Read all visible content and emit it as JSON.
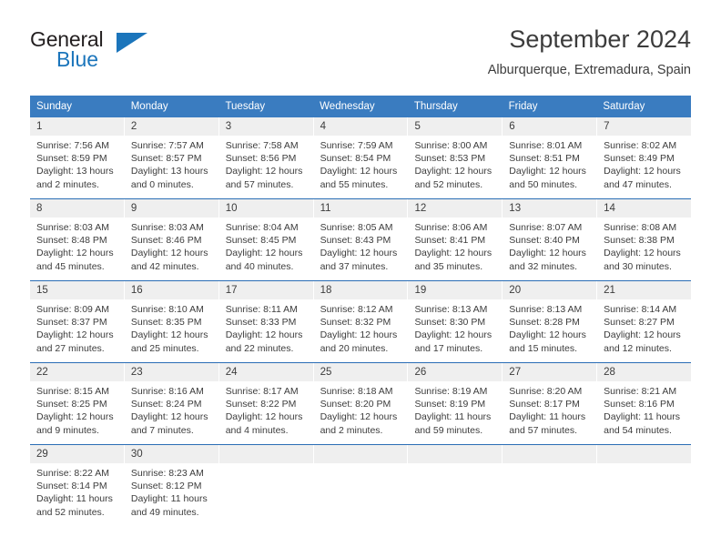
{
  "brand": {
    "name_top": "General",
    "name_bottom": "Blue",
    "accent_color": "#1b75bb"
  },
  "header": {
    "title": "September 2024",
    "subtitle": "Alburquerque, Extremadura, Spain"
  },
  "calendar": {
    "header_bg": "#3a7cc0",
    "row_divider_color": "#2a6db5",
    "day_number_bg": "#efefef",
    "weekdays": [
      "Sunday",
      "Monday",
      "Tuesday",
      "Wednesday",
      "Thursday",
      "Friday",
      "Saturday"
    ],
    "weeks": [
      [
        {
          "day": "1",
          "sunrise": "Sunrise: 7:56 AM",
          "sunset": "Sunset: 8:59 PM",
          "daylight_line1": "Daylight: 13 hours",
          "daylight_line2": "and 2 minutes."
        },
        {
          "day": "2",
          "sunrise": "Sunrise: 7:57 AM",
          "sunset": "Sunset: 8:57 PM",
          "daylight_line1": "Daylight: 13 hours",
          "daylight_line2": "and 0 minutes."
        },
        {
          "day": "3",
          "sunrise": "Sunrise: 7:58 AM",
          "sunset": "Sunset: 8:56 PM",
          "daylight_line1": "Daylight: 12 hours",
          "daylight_line2": "and 57 minutes."
        },
        {
          "day": "4",
          "sunrise": "Sunrise: 7:59 AM",
          "sunset": "Sunset: 8:54 PM",
          "daylight_line1": "Daylight: 12 hours",
          "daylight_line2": "and 55 minutes."
        },
        {
          "day": "5",
          "sunrise": "Sunrise: 8:00 AM",
          "sunset": "Sunset: 8:53 PM",
          "daylight_line1": "Daylight: 12 hours",
          "daylight_line2": "and 52 minutes."
        },
        {
          "day": "6",
          "sunrise": "Sunrise: 8:01 AM",
          "sunset": "Sunset: 8:51 PM",
          "daylight_line1": "Daylight: 12 hours",
          "daylight_line2": "and 50 minutes."
        },
        {
          "day": "7",
          "sunrise": "Sunrise: 8:02 AM",
          "sunset": "Sunset: 8:49 PM",
          "daylight_line1": "Daylight: 12 hours",
          "daylight_line2": "and 47 minutes."
        }
      ],
      [
        {
          "day": "8",
          "sunrise": "Sunrise: 8:03 AM",
          "sunset": "Sunset: 8:48 PM",
          "daylight_line1": "Daylight: 12 hours",
          "daylight_line2": "and 45 minutes."
        },
        {
          "day": "9",
          "sunrise": "Sunrise: 8:03 AM",
          "sunset": "Sunset: 8:46 PM",
          "daylight_line1": "Daylight: 12 hours",
          "daylight_line2": "and 42 minutes."
        },
        {
          "day": "10",
          "sunrise": "Sunrise: 8:04 AM",
          "sunset": "Sunset: 8:45 PM",
          "daylight_line1": "Daylight: 12 hours",
          "daylight_line2": "and 40 minutes."
        },
        {
          "day": "11",
          "sunrise": "Sunrise: 8:05 AM",
          "sunset": "Sunset: 8:43 PM",
          "daylight_line1": "Daylight: 12 hours",
          "daylight_line2": "and 37 minutes."
        },
        {
          "day": "12",
          "sunrise": "Sunrise: 8:06 AM",
          "sunset": "Sunset: 8:41 PM",
          "daylight_line1": "Daylight: 12 hours",
          "daylight_line2": "and 35 minutes."
        },
        {
          "day": "13",
          "sunrise": "Sunrise: 8:07 AM",
          "sunset": "Sunset: 8:40 PM",
          "daylight_line1": "Daylight: 12 hours",
          "daylight_line2": "and 32 minutes."
        },
        {
          "day": "14",
          "sunrise": "Sunrise: 8:08 AM",
          "sunset": "Sunset: 8:38 PM",
          "daylight_line1": "Daylight: 12 hours",
          "daylight_line2": "and 30 minutes."
        }
      ],
      [
        {
          "day": "15",
          "sunrise": "Sunrise: 8:09 AM",
          "sunset": "Sunset: 8:37 PM",
          "daylight_line1": "Daylight: 12 hours",
          "daylight_line2": "and 27 minutes."
        },
        {
          "day": "16",
          "sunrise": "Sunrise: 8:10 AM",
          "sunset": "Sunset: 8:35 PM",
          "daylight_line1": "Daylight: 12 hours",
          "daylight_line2": "and 25 minutes."
        },
        {
          "day": "17",
          "sunrise": "Sunrise: 8:11 AM",
          "sunset": "Sunset: 8:33 PM",
          "daylight_line1": "Daylight: 12 hours",
          "daylight_line2": "and 22 minutes."
        },
        {
          "day": "18",
          "sunrise": "Sunrise: 8:12 AM",
          "sunset": "Sunset: 8:32 PM",
          "daylight_line1": "Daylight: 12 hours",
          "daylight_line2": "and 20 minutes."
        },
        {
          "day": "19",
          "sunrise": "Sunrise: 8:13 AM",
          "sunset": "Sunset: 8:30 PM",
          "daylight_line1": "Daylight: 12 hours",
          "daylight_line2": "and 17 minutes."
        },
        {
          "day": "20",
          "sunrise": "Sunrise: 8:13 AM",
          "sunset": "Sunset: 8:28 PM",
          "daylight_line1": "Daylight: 12 hours",
          "daylight_line2": "and 15 minutes."
        },
        {
          "day": "21",
          "sunrise": "Sunrise: 8:14 AM",
          "sunset": "Sunset: 8:27 PM",
          "daylight_line1": "Daylight: 12 hours",
          "daylight_line2": "and 12 minutes."
        }
      ],
      [
        {
          "day": "22",
          "sunrise": "Sunrise: 8:15 AM",
          "sunset": "Sunset: 8:25 PM",
          "daylight_line1": "Daylight: 12 hours",
          "daylight_line2": "and 9 minutes."
        },
        {
          "day": "23",
          "sunrise": "Sunrise: 8:16 AM",
          "sunset": "Sunset: 8:24 PM",
          "daylight_line1": "Daylight: 12 hours",
          "daylight_line2": "and 7 minutes."
        },
        {
          "day": "24",
          "sunrise": "Sunrise: 8:17 AM",
          "sunset": "Sunset: 8:22 PM",
          "daylight_line1": "Daylight: 12 hours",
          "daylight_line2": "and 4 minutes."
        },
        {
          "day": "25",
          "sunrise": "Sunrise: 8:18 AM",
          "sunset": "Sunset: 8:20 PM",
          "daylight_line1": "Daylight: 12 hours",
          "daylight_line2": "and 2 minutes."
        },
        {
          "day": "26",
          "sunrise": "Sunrise: 8:19 AM",
          "sunset": "Sunset: 8:19 PM",
          "daylight_line1": "Daylight: 11 hours",
          "daylight_line2": "and 59 minutes."
        },
        {
          "day": "27",
          "sunrise": "Sunrise: 8:20 AM",
          "sunset": "Sunset: 8:17 PM",
          "daylight_line1": "Daylight: 11 hours",
          "daylight_line2": "and 57 minutes."
        },
        {
          "day": "28",
          "sunrise": "Sunrise: 8:21 AM",
          "sunset": "Sunset: 8:16 PM",
          "daylight_line1": "Daylight: 11 hours",
          "daylight_line2": "and 54 minutes."
        }
      ],
      [
        {
          "day": "29",
          "sunrise": "Sunrise: 8:22 AM",
          "sunset": "Sunset: 8:14 PM",
          "daylight_line1": "Daylight: 11 hours",
          "daylight_line2": "and 52 minutes."
        },
        {
          "day": "30",
          "sunrise": "Sunrise: 8:23 AM",
          "sunset": "Sunset: 8:12 PM",
          "daylight_line1": "Daylight: 11 hours",
          "daylight_line2": "and 49 minutes."
        },
        {
          "day": "",
          "sunrise": "",
          "sunset": "",
          "daylight_line1": "",
          "daylight_line2": ""
        },
        {
          "day": "",
          "sunrise": "",
          "sunset": "",
          "daylight_line1": "",
          "daylight_line2": ""
        },
        {
          "day": "",
          "sunrise": "",
          "sunset": "",
          "daylight_line1": "",
          "daylight_line2": ""
        },
        {
          "day": "",
          "sunrise": "",
          "sunset": "",
          "daylight_line1": "",
          "daylight_line2": ""
        },
        {
          "day": "",
          "sunrise": "",
          "sunset": "",
          "daylight_line1": "",
          "daylight_line2": ""
        }
      ]
    ]
  }
}
